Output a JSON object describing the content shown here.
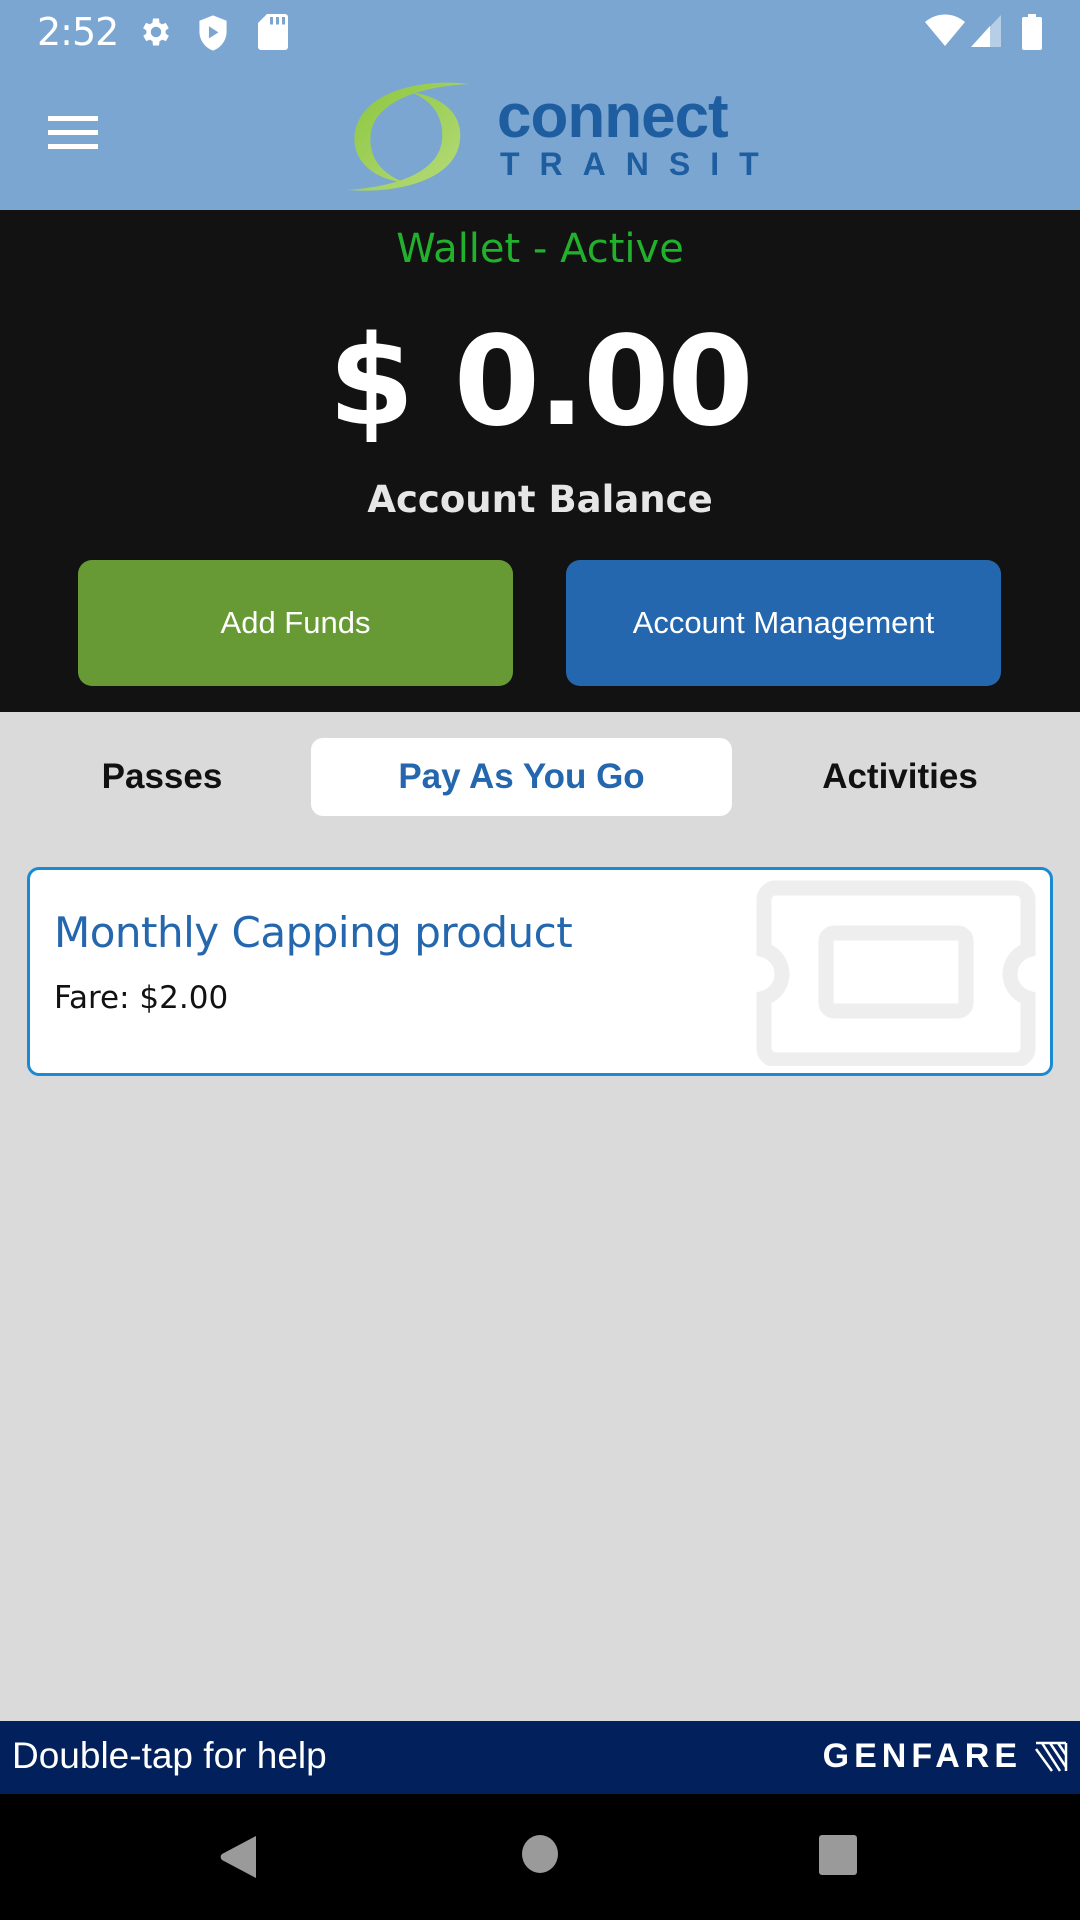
{
  "status_bar": {
    "time": "2:52",
    "left_icons": [
      "gear-icon",
      "shield-play-icon",
      "sd-card-icon"
    ],
    "right_icons": [
      "wifi-icon",
      "cell-signal-icon",
      "battery-icon"
    ]
  },
  "header": {
    "menu_icon": "hamburger-menu-icon",
    "logo": {
      "line1": "connect",
      "line2": "TRANSIT"
    },
    "colors": {
      "background": "#7ba6d2",
      "logo_blue": "#1e5d9f",
      "logo_green": "#7fc241"
    }
  },
  "wallet": {
    "status": "Wallet - Active",
    "balance": "$ 0.00",
    "balance_label": "Account Balance",
    "buttons": {
      "add_funds": "Add Funds",
      "account_management": "Account Management"
    },
    "colors": {
      "status": "#22b12c",
      "add_funds": "#679a35",
      "account_management": "#2467ae"
    }
  },
  "tabs": [
    {
      "label": "Passes",
      "active": false
    },
    {
      "label": "Pay As You Go",
      "active": true
    },
    {
      "label": "Activities",
      "active": false
    }
  ],
  "products": [
    {
      "title": "Monthly Capping product",
      "fare": "Fare: $2.00",
      "icon": "ticket-icon"
    }
  ],
  "footer": {
    "help_text": "Double-tap for help",
    "brand": "GENFARE"
  },
  "nav": {
    "back": "back-icon",
    "home": "home-icon",
    "recents": "recents-icon"
  }
}
